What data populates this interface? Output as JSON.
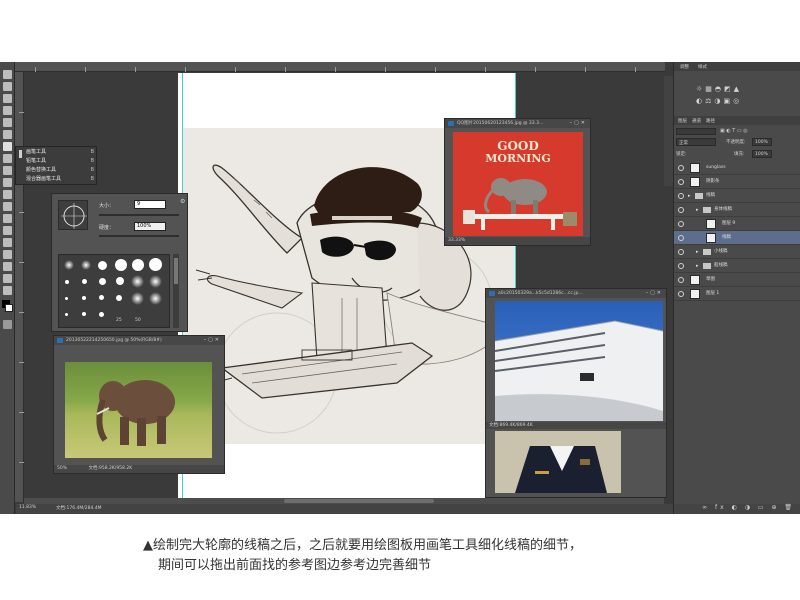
{
  "accent_selection": "#5c6e8c",
  "context_menu": {
    "items": [
      {
        "label": "画笔工具",
        "key": "B"
      },
      {
        "label": "铅笔工具",
        "key": "B"
      },
      {
        "label": "颜色替换工具",
        "key": "B"
      },
      {
        "label": "混合器画笔工具",
        "key": "B"
      }
    ]
  },
  "brush_panel": {
    "size_label": "大小：",
    "size_value": "9",
    "hardness_label": "硬度：",
    "hardness_value": "100%",
    "preset_labels": [
      "25",
      "50"
    ]
  },
  "doc_status": {
    "zoom": "11.83%",
    "doc_info": "文档:176.4M/284.4M"
  },
  "windows": {
    "good_morning": {
      "title": "QQ图片20150620123456.jpg @ 33.3...",
      "zoom": "33.33%",
      "poster_text_1": "GOOD",
      "poster_text_2": "MORNING"
    },
    "elephant": {
      "title": "20130522214250650.jpg @ 50%(RGB/8#)",
      "zoom": "50%",
      "doc": "文档:958.2K/958.2K"
    },
    "ship": {
      "title": "a0c20150329a...k5c5d1286c...cc.jp...",
      "doc": "文档:869.4K/869.4K"
    }
  },
  "right_panel": {
    "tabs_top": [
      "调整",
      "样式"
    ],
    "tabs_layers": [
      "图层",
      "通道",
      "路径"
    ],
    "blend_mode": "正常",
    "opacity_label": "不透明度:",
    "opacity_value": "100%",
    "fill_label": "填充:",
    "fill_value": "100%",
    "lock_label": "锁定:",
    "layers": [
      {
        "name": "sunglass",
        "kind": "layer",
        "indent": 0
      },
      {
        "name": "阴影条",
        "kind": "layer",
        "indent": 0
      },
      {
        "name": "线稿",
        "kind": "group",
        "indent": 0
      },
      {
        "name": "身体线稿",
        "kind": "group",
        "indent": 1
      },
      {
        "name": "图层 9",
        "kind": "layer",
        "indent": 2
      },
      {
        "name": "线稿",
        "kind": "layer",
        "indent": 2,
        "selected": true
      },
      {
        "name": "小线稿",
        "kind": "group",
        "indent": 1
      },
      {
        "name": "船线稿",
        "kind": "group",
        "indent": 1
      },
      {
        "name": "草图",
        "kind": "layer",
        "indent": 0
      },
      {
        "name": "图层 1",
        "kind": "layer",
        "indent": 0
      }
    ]
  },
  "caption": {
    "line1": "▲绘制完大轮廓的线稿之后，之后就要用绘图板用画笔工具细化线稿的细节，",
    "line2": "期间可以拖出前面找的参考图边参考边完善细节"
  }
}
